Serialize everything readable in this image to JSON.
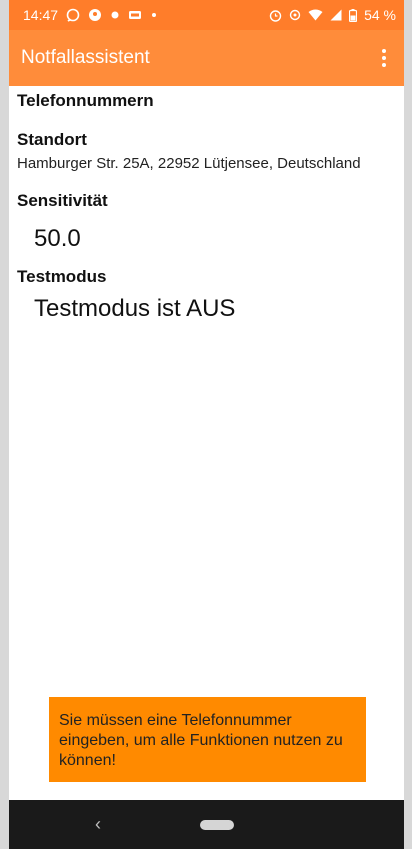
{
  "status_bar": {
    "time": "14:47",
    "battery": "54 %",
    "left_icons": [
      "whatsapp-icon",
      "location-pin-app-icon",
      "dot-icon",
      "notification-icon",
      "small-dot-icon"
    ],
    "right_icons": [
      "alarm-icon",
      "location-icon",
      "wifi-icon",
      "signal-icon",
      "battery-icon"
    ]
  },
  "app_bar": {
    "title": "Notfallassistent",
    "menu_icon": "more-vert-icon"
  },
  "sections": {
    "phone_numbers_title": "Telefonnummern",
    "location_title": "Standort",
    "location_value": "Hamburger Str. 25A, 22952 Lütjensee, Deutschland",
    "sensitivity_title": "Sensitivität",
    "sensitivity_value": "50.0",
    "test_mode_title": "Testmodus",
    "test_mode_value": "Testmodus ist AUS"
  },
  "toast": {
    "message": "Sie müssen eine Telefonnummer eingeben, um alle Funktionen nutzen zu können!"
  },
  "nav_bar": {
    "back_icon": "back-chevron-icon",
    "home_icon": "home-pill-icon"
  },
  "colors": {
    "status_bar": "#ff7d2a",
    "app_bar": "#ff8c3a",
    "toast": "#ff8a00",
    "nav_bar": "#1a1a1a"
  }
}
